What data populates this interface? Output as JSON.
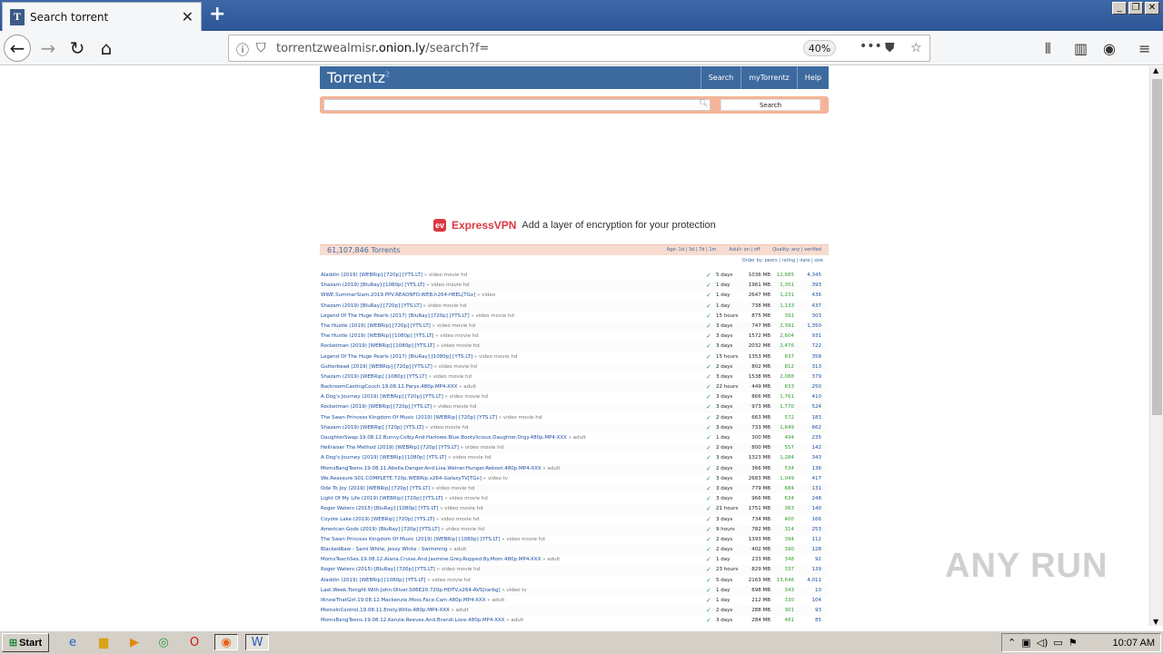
{
  "browser": {
    "tab_title": "Search torrent",
    "favicon_letter": "T",
    "url_host_prefix": "torrentzwealmisr",
    "url_host_main": ".onion.ly",
    "url_path": "/search?f=",
    "zoom": "40%"
  },
  "site": {
    "logo": "Torrentz",
    "logo_sup": "2",
    "nav": [
      "Search",
      "myTorrentz",
      "Help"
    ],
    "search_button": "Search",
    "search_value": ""
  },
  "ad": {
    "brand": "ExpressVPN",
    "text": "Add a layer of encryption for your protection"
  },
  "results": {
    "count": "61,107,846 Torrents",
    "age_filter": "Age: 1d | 3d | 7d | 1m",
    "adult_filter": "Adult: on | off",
    "quality_filter": "Quality: any | verified",
    "order_by": "Order by: peers | rating | date | size",
    "rows": [
      {
        "title": "Aladdin (2019) [WEBRip] [720p] [YTS.LT]",
        "cat": "» video movie hd",
        "age": "5 days",
        "size": "1036 MB",
        "seeds": "12,685",
        "peers": "4,345"
      },
      {
        "title": "Shazam (2019) [BluRay] [1080p] [YTS.LT]",
        "cat": "» video movie hd",
        "age": "1 day",
        "size": "1961 MB",
        "seeds": "1,351",
        "peers": "393"
      },
      {
        "title": "WWE.SummerSlam.2019.PPV.READNFO.WEB.h264-HEEL[TGx]",
        "cat": "» video",
        "age": "1 day",
        "size": "2647 MB",
        "seeds": "1,231",
        "peers": "436"
      },
      {
        "title": "Shazam (2019) [BluRay] [720p] [YTS.LT]",
        "cat": "» video movie hd",
        "age": "1 day",
        "size": "738 MB",
        "seeds": "1,133",
        "peers": "437"
      },
      {
        "title": "Legend Of The Huge Pearls (2017) [BluRay] [720p] [YTS.LT]",
        "cat": "» video movie hd",
        "age": "15 hours",
        "size": "875 MB",
        "seeds": "391",
        "peers": "303"
      },
      {
        "title": "The Hustle (2019) [WEBRip] [720p] [YTS.LT]",
        "cat": "» video movie hd",
        "age": "3 days",
        "size": "747 MB",
        "seeds": "2,391",
        "peers": "1,350"
      },
      {
        "title": "The Hustle (2019) [WEBRip] [1080p] [YTS.LT]",
        "cat": "» video movie hd",
        "age": "3 days",
        "size": "1572 MB",
        "seeds": "2,604",
        "peers": "931"
      },
      {
        "title": "Rocketman (2019) [WEBRip] [1080p] [YTS.LT]",
        "cat": "» video movie hd",
        "age": "3 days",
        "size": "2032 MB",
        "seeds": "2,476",
        "peers": "722"
      },
      {
        "title": "Legend Of The Huge Pearls (2017) [BluRay] [1080p] [YTS.LT]",
        "cat": "» video movie hd",
        "age": "15 hours",
        "size": "1353 MB",
        "seeds": "637",
        "peers": "358"
      },
      {
        "title": "Gutterbead (2019) [WEBRip] [720p] [YTS.LT]",
        "cat": "» video movie hd",
        "age": "2 days",
        "size": "802 MB",
        "seeds": "812",
        "peers": "313"
      },
      {
        "title": "Shazam (2019) [WEBRip] [1080p] [YTS.LT]",
        "cat": "» video movie hd",
        "age": "3 days",
        "size": "1538 MB",
        "seeds": "2,088",
        "peers": "379"
      },
      {
        "title": "BackroomCastingCouch.19.08.12.Parys.480p.MP4-XXX",
        "cat": "» adult",
        "age": "22 hours",
        "size": "449 MB",
        "seeds": "633",
        "peers": "250"
      },
      {
        "title": "A Dog's Journey (2019) [WEBRip] [720p] [YTS.LT]",
        "cat": "» video movie hd",
        "age": "3 days",
        "size": "866 MB",
        "seeds": "1,761",
        "peers": "410"
      },
      {
        "title": "Rocketman (2019) [WEBRip] [720p] [YTS.LT]",
        "cat": "» video movie hd",
        "age": "3 days",
        "size": "973 MB",
        "seeds": "1,770",
        "peers": "524"
      },
      {
        "title": "The Swan Princess Kingdom Of Music (2019) [WEBRip] [720p] [YTS.LT]",
        "cat": "» video movie hd",
        "age": "2 days",
        "size": "663 MB",
        "seeds": "572",
        "peers": "183"
      },
      {
        "title": "Shazam (2019) [WEBRip] [720p] [YTS.LT]",
        "cat": "» video movie hd",
        "age": "3 days",
        "size": "733 MB",
        "seeds": "1,649",
        "peers": "662"
      },
      {
        "title": "DaughterSwap.19.08.12.Bunny.Colby.And.Harlowe.Blue.Bootylicious.Daughter.Orgy.480p.MP4-XXX",
        "cat": "» adult",
        "age": "1 day",
        "size": "300 MB",
        "seeds": "494",
        "peers": "235"
      },
      {
        "title": "Hellraiser The Method (2019) [WEBRip] [720p] [YTS.LT]",
        "cat": "» video movie hd",
        "age": "2 days",
        "size": "800 MB",
        "seeds": "557",
        "peers": "142"
      },
      {
        "title": "A Dog's Journey (2019) [WEBRip] [1080p] [YTS.LT]",
        "cat": "» video movie hd",
        "age": "3 days",
        "size": "1323 MB",
        "seeds": "1,284",
        "peers": "343"
      },
      {
        "title": "MomsBangTeens.19.08.11.Abella.Danger.And.Lisa.Weiner.Hunger.Reboot.480p.MP4-XXX",
        "cat": "» adult",
        "age": "2 days",
        "size": "366 MB",
        "seeds": "534",
        "peers": "136"
      },
      {
        "title": "We.Reassure.S01.COMPLETE.720p.WEBRip.x264-GalaxyTV[TGx]",
        "cat": "» video tv",
        "age": "3 days",
        "size": "2683 MB",
        "seeds": "1,049",
        "peers": "417"
      },
      {
        "title": "Ode To Joy (2019) [WEBRip] [720p] [YTS.LT]",
        "cat": "» video movie hd",
        "age": "3 days",
        "size": "779 MB",
        "seeds": "684",
        "peers": "131"
      },
      {
        "title": "Light Of My Life (2019) [WEBRip] [720p] [YTS.LT]",
        "cat": "» video movie hd",
        "age": "3 days",
        "size": "966 MB",
        "seeds": "634",
        "peers": "248"
      },
      {
        "title": "Roger Waters (2015) [BluRay] [1080p] [YTS.LT]",
        "cat": "» video movie hd",
        "age": "21 hours",
        "size": "1751 MB",
        "seeds": "363",
        "peers": "140"
      },
      {
        "title": "Coyote Lake (2019) [WEBRip] [720p] [YTS.LT]",
        "cat": "» video movie hd",
        "age": "3 days",
        "size": "734 MB",
        "seeds": "400",
        "peers": "166"
      },
      {
        "title": "American Gods (2019) [BluRay] [720p] [YTS.LT]",
        "cat": "» video movie hd",
        "age": "9 hours",
        "size": "782 MB",
        "seeds": "314",
        "peers": "253"
      },
      {
        "title": "The Swan Princess Kingdom Of Music (2019) [WEBRip] [1080p] [YTS.LT]",
        "cat": "» video movie hd",
        "age": "2 days",
        "size": "1393 MB",
        "seeds": "394",
        "peers": "112"
      },
      {
        "title": "BlackedRaw - Sami White, Jessy White - Swimming",
        "cat": "» adult",
        "age": "2 days",
        "size": "402 MB",
        "seeds": "390",
        "peers": "128"
      },
      {
        "title": "MomsTeachSex.19.08.12.Alana.Cruise.And.Jasmine.Grey.Ropped.By.Mom.480p.MP4-XXX",
        "cat": "» adult",
        "age": "1 day",
        "size": "233 MB",
        "seeds": "348",
        "peers": "92"
      },
      {
        "title": "Roger Waters (2015) [BluRay] [720p] [YTS.LT]",
        "cat": "» video movie hd",
        "age": "23 hours",
        "size": "829 MB",
        "seeds": "337",
        "peers": "139"
      },
      {
        "title": "Aladdin (2019) [WEBRip] [1080p] [YTS.LT]",
        "cat": "» video movie hd",
        "age": "5 days",
        "size": "2163 MB",
        "seeds": "13,646",
        "peers": "4,011"
      },
      {
        "title": "Last.Week.Tonight.With.John.Oliver.S06E20.720p.HDTV.x264-AVS[rarbg]",
        "cat": "» video tv",
        "age": "1 day",
        "size": "698 MB",
        "seeds": "343",
        "peers": "10"
      },
      {
        "title": "IKnowThatGirl.19.08.12.Mackenzie.Moss.Face.Cam.480p.MP4-XXX",
        "cat": "» adult",
        "age": "1 day",
        "size": "212 MB",
        "seeds": "330",
        "peers": "104"
      },
      {
        "title": "MomsInControl.19.08.11.Emily.Willis.480p.MP4-XXX",
        "cat": "» adult",
        "age": "2 days",
        "size": "288 MB",
        "seeds": "301",
        "peers": "93"
      },
      {
        "title": "MomsBangTeens.19.08.12.Kenzie.Reeves.And.Brandi.Love.480p.MP4-XXX",
        "cat": "» adult",
        "age": "3 days",
        "size": "284 MB",
        "seeds": "481",
        "peers": "85"
      }
    ]
  },
  "watermark": "ANY RUN",
  "taskbar": {
    "start_label": "Start",
    "clock": "10:07 AM"
  },
  "colors": {
    "site_header": "#3d6a9e",
    "search_band": "#f5b497",
    "link": "#1a4fa0",
    "seeds": "#2e9e2e"
  }
}
